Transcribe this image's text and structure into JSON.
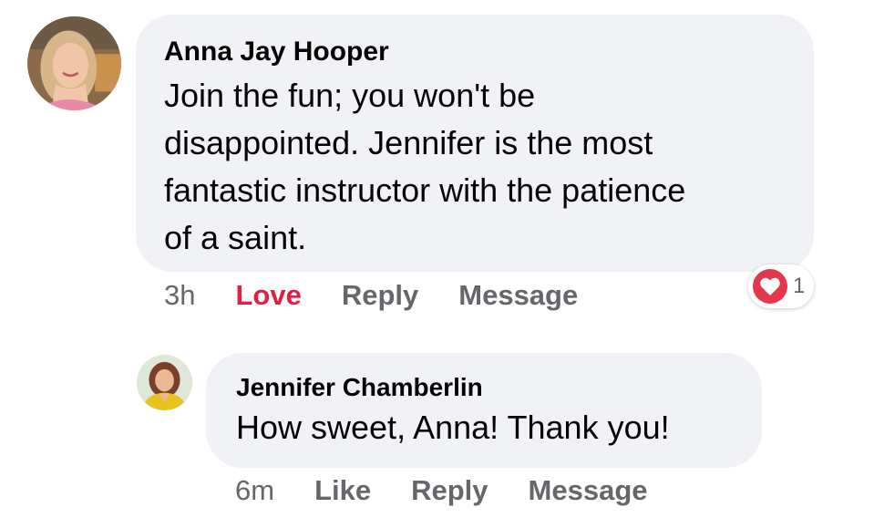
{
  "comments": [
    {
      "author": "Anna Jay Hooper",
      "text": "Join the fun; you won't be\ndisappointed. Jennifer is the most\nfantastic instructor with the patience\nof a saint.",
      "time": "3h",
      "actions": [
        "Love",
        "Reply",
        "Message"
      ],
      "reaction": {
        "icon": "heart-icon",
        "count": "1",
        "color": "#e4364d"
      }
    },
    {
      "author": "Jennifer Chamberlin",
      "text": "How sweet, Anna! Thank you!",
      "time": "6m",
      "actions": [
        "Like",
        "Reply",
        "Message"
      ]
    }
  ],
  "colors": {
    "bubble": "#f0f2f5",
    "text": "#050505",
    "meta": "#65676b",
    "love": "#e41e3f"
  }
}
